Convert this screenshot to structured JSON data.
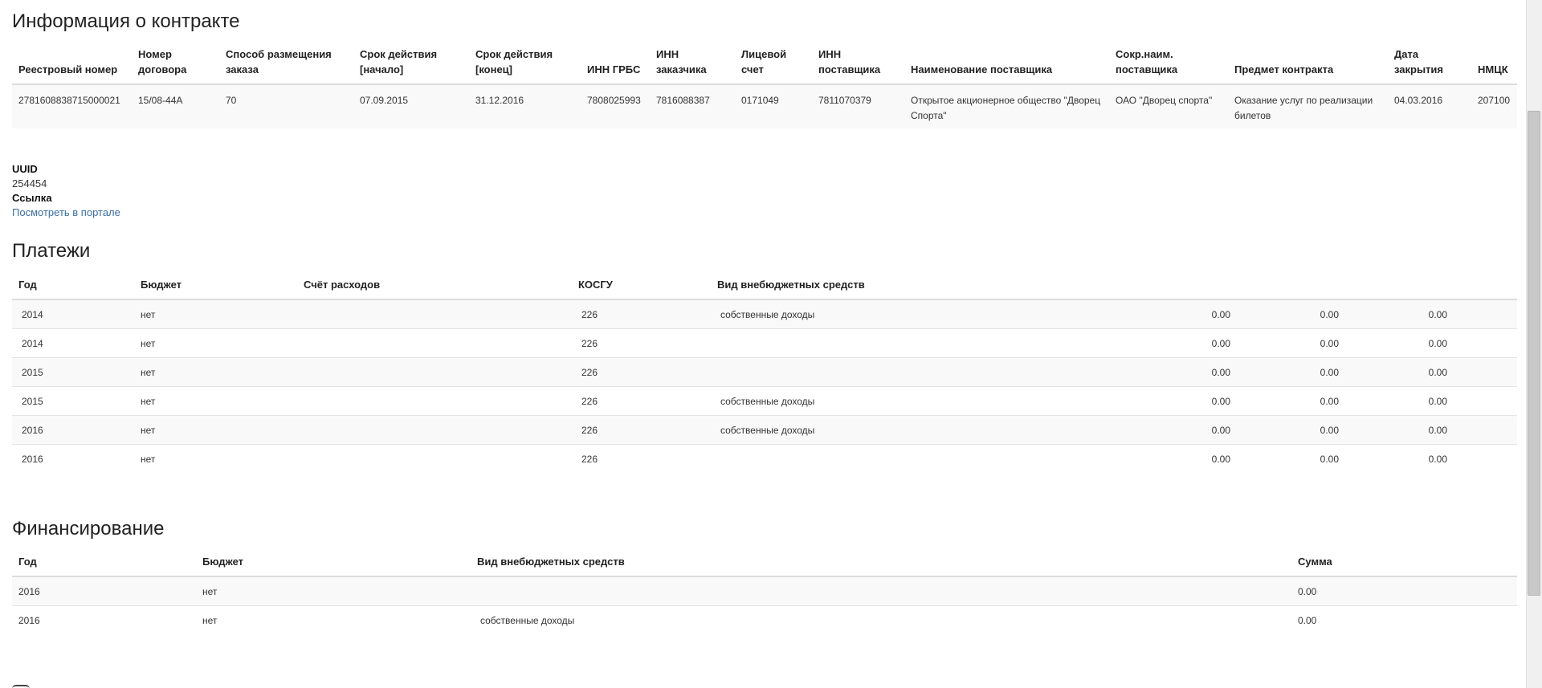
{
  "contract": {
    "title": "Информация о контракте",
    "headers": [
      "Реестровый номер",
      "Номер договора",
      "Способ размещения заказа",
      "Срок действия [начало]",
      "Срок действия [конец]",
      "ИНН ГРБС",
      "ИНН заказчика",
      "Лицевой счет",
      "ИНН поставщика",
      "Наименование поставщика",
      "Сокр.наим. поставщика",
      "Предмет контракта",
      "Дата закрытия",
      "НМЦК"
    ],
    "row": [
      "2781608838715000021",
      "15/08-44A",
      "70",
      "07.09.2015",
      "31.12.2016",
      "7808025993",
      "7816088387",
      "0171049",
      "7811070379",
      "Открытое акционерное общество \"Дворец Спорта\"",
      "ОАО \"Дворец спорта\"",
      "Оказание услуг по реализации билетов",
      "04.03.2016",
      "207100"
    ]
  },
  "uuid": {
    "label": "UUID",
    "value": "254454"
  },
  "link": {
    "label": "Ссылка",
    "text": "Посмотреть в портале"
  },
  "payments": {
    "title": "Платежи",
    "headers": [
      "Год",
      "Бюджет",
      "Счёт расходов",
      "КОСГУ",
      "Вид внебюджетных средств"
    ],
    "rows": [
      [
        "2014",
        "нет",
        "",
        "226",
        "собственные доходы",
        "0.00",
        "0.00",
        "0.00"
      ],
      [
        "2014",
        "нет",
        "",
        "226",
        "",
        "0.00",
        "0.00",
        "0.00"
      ],
      [
        "2015",
        "нет",
        "",
        "226",
        "",
        "0.00",
        "0.00",
        "0.00"
      ],
      [
        "2015",
        "нет",
        "",
        "226",
        "собственные доходы",
        "0.00",
        "0.00",
        "0.00"
      ],
      [
        "2016",
        "нет",
        "",
        "226",
        "собственные доходы",
        "0.00",
        "0.00",
        "0.00"
      ],
      [
        "2016",
        "нет",
        "",
        "226",
        "",
        "0.00",
        "0.00",
        "0.00"
      ]
    ]
  },
  "financing": {
    "title": "Финансирование",
    "headers": [
      "Год",
      "Бюджет",
      "Вид внебюджетных средств",
      "Сумма"
    ],
    "rows": [
      [
        "2016",
        "нет",
        "",
        "0.00"
      ],
      [
        "2016",
        "нет",
        "собственные доходы",
        "0.00"
      ]
    ]
  }
}
